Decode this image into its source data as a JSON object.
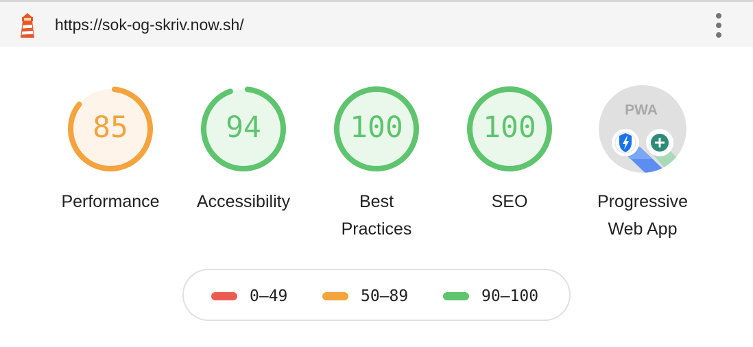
{
  "header": {
    "url": "https://sok-og-skriv.now.sh/",
    "logo_icon": "lighthouse-icon",
    "menu_icon": "kebab-menu-icon"
  },
  "categories": [
    {
      "id": "performance",
      "score": "85",
      "score_value": 85,
      "label": "Performance",
      "status": "average",
      "color": "#f4a33d",
      "fill": "#fef4ea"
    },
    {
      "id": "accessibility",
      "score": "94",
      "score_value": 94,
      "label": "Accessibility",
      "status": "pass",
      "color": "#5ec46e",
      "fill": "#eaf8ec"
    },
    {
      "id": "best-practices",
      "score": "100",
      "score_value": 100,
      "label_line1": "Best",
      "label_line2": "Practices",
      "status": "pass",
      "color": "#5ec46e",
      "fill": "#eaf8ec"
    },
    {
      "id": "seo",
      "score": "100",
      "score_value": 100,
      "label": "SEO",
      "status": "pass",
      "color": "#5ec46e",
      "fill": "#eaf8ec"
    },
    {
      "id": "pwa",
      "badge_text": "PWA",
      "label_line1": "Progressive",
      "label_line2": "Web App",
      "badges": [
        "fast-reliable-icon",
        "installable-icon"
      ]
    }
  ],
  "legend": [
    {
      "range": "0–49",
      "color": "#eb5d50"
    },
    {
      "range": "50–89",
      "color": "#f4a33d"
    },
    {
      "range": "90–100",
      "color": "#5ec46e"
    }
  ]
}
